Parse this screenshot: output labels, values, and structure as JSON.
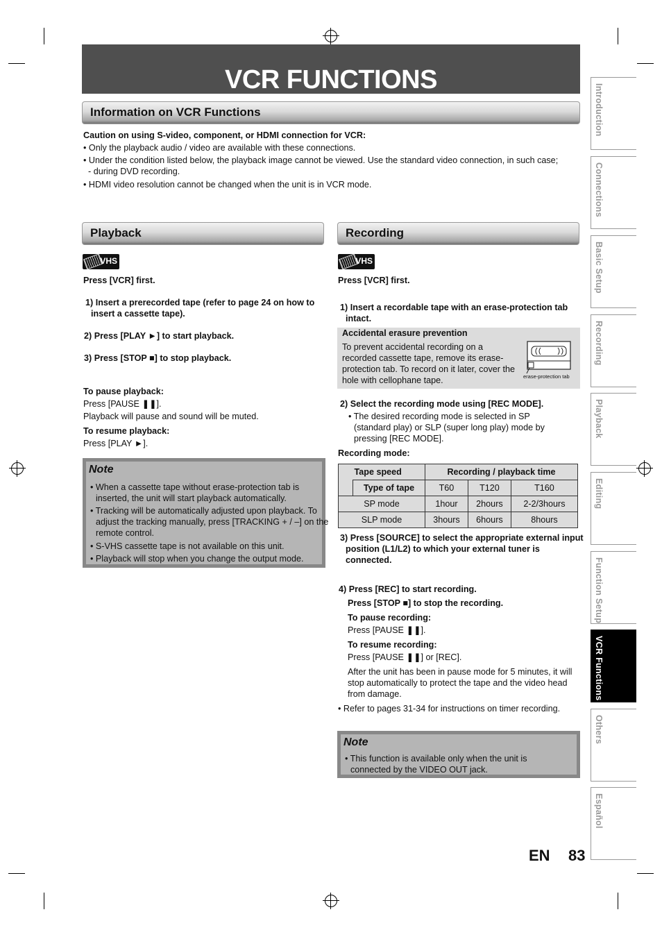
{
  "page": {
    "title": "VCR FUNCTIONS",
    "lang_label": "EN",
    "page_number": "83"
  },
  "info": {
    "heading": "Information on VCR Functions",
    "caution_title": "Caution on using S-video, component, or HDMI connection for VCR:",
    "bullets": [
      "• Only the playback audio / video are available with these connections.",
      "• Under the condition listed below, the playback image cannot be viewed. Use the standard video connection, in such case;",
      "- during DVD recording.",
      "• HDMI video resolution cannot be changed when the unit is in VCR mode."
    ]
  },
  "playback": {
    "heading": "Playback",
    "badge": "VHS",
    "press_first": "Press [VCR] first.",
    "steps": [
      "1) Insert a prerecorded tape (refer to page 24 on how to insert a cassette tape).",
      "2) Press [PLAY ►] to start playback.",
      "3) Press [STOP ■] to stop playback."
    ],
    "pause_title": "To pause playback:",
    "pause_press": "Press [PAUSE ❚❚].",
    "pause_desc": "Playback will pause and sound will be muted.",
    "resume_title": "To resume playback:",
    "resume_press": "Press [PLAY ►].",
    "note": {
      "title": "Note",
      "items": [
        "• When a cassette tape without erase-protection tab is inserted, the unit will start playback automatically.",
        "• Tracking will be automatically adjusted upon playback. To adjust the tracking manually, press [TRACKING + / –] on the remote control.",
        "• S-VHS cassette tape is not available on this unit.",
        "• Playback will stop when you change the output mode."
      ]
    }
  },
  "recording": {
    "heading": "Recording",
    "badge": "VHS",
    "press_first": "Press [VCR] first.",
    "step1": "1) Insert a recordable tape with an erase-protection tab intact.",
    "erase_box": {
      "title": "Accidental erasure prevention",
      "text": "To prevent accidental recording on a recorded cassette tape, remove its erase-protection tab. To record on it later, cover the hole with cellophane tape.",
      "caption": "erase-protection tab"
    },
    "step2": "2) Select the recording mode using [REC MODE].",
    "step2_bullet": "• The desired recording mode is selected in SP (standard play) or SLP (super long play) mode by pressing [REC MODE].",
    "mode_label": "Recording mode:",
    "table": {
      "h_speed": "Tape speed",
      "h_time": "Recording / playback time",
      "h_type": "Type of tape",
      "tapes": [
        "T60",
        "T120",
        "T160"
      ],
      "rows": [
        {
          "mode": "SP mode",
          "values": [
            "1hour",
            "2hours",
            "2-2/3hours"
          ]
        },
        {
          "mode": "SLP mode",
          "values": [
            "3hours",
            "6hours",
            "8hours"
          ]
        }
      ]
    },
    "step3": "3) Press [SOURCE] to select the appropriate external input position (L1/L2) to which your external tuner is connected.",
    "step4": "4) Press [REC] to start recording.",
    "stop": "Press [STOP ■] to stop the recording.",
    "pause_title": "To pause recording:",
    "pause_press": "Press [PAUSE ❚❚].",
    "resume_title": "To resume recording:",
    "resume_press": "Press [PAUSE ❚❚] or [REC].",
    "auto_stop": "After the unit has been in pause mode for 5 minutes, it will stop automatically to protect the tape and the video head from damage.",
    "timer_ref": "• Refer to pages 31-34 for instructions on timer recording.",
    "note": {
      "title": "Note",
      "items": [
        "• This function is available only when the unit is connected by the VIDEO OUT jack."
      ]
    }
  },
  "side_tabs": [
    {
      "label": "Introduction",
      "active": false
    },
    {
      "label": "Connections",
      "active": false
    },
    {
      "label": "Basic Setup",
      "active": false
    },
    {
      "label": "Recording",
      "active": false
    },
    {
      "label": "Playback",
      "active": false
    },
    {
      "label": "Editing",
      "active": false
    },
    {
      "label": "Function Setup",
      "active": false
    },
    {
      "label": "VCR Functions",
      "active": true
    },
    {
      "label": "Others",
      "active": false
    },
    {
      "label": "Español",
      "active": false
    }
  ]
}
